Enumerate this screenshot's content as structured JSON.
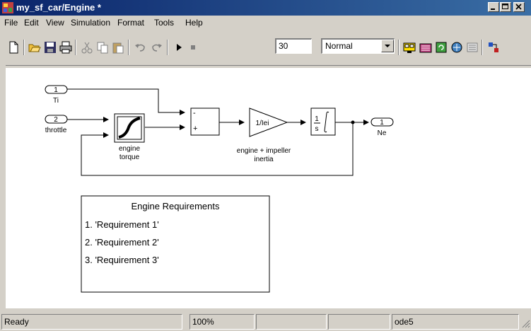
{
  "window": {
    "title": "my_sf_car/Engine *"
  },
  "menu": [
    "File",
    "Edit",
    "View",
    "Simulation",
    "Format",
    "Tools",
    "Help"
  ],
  "toolbar": {
    "stop_time": "30",
    "sim_mode": "Normal"
  },
  "diagram": {
    "inport_ti": {
      "num": "1",
      "label": "Ti"
    },
    "inport_throttle": {
      "num": "2",
      "label": "throttle"
    },
    "engine_torque_label": [
      "engine",
      "torque"
    ],
    "sum_signs": [
      "-",
      "+"
    ],
    "gain": {
      "text": "1/Iei",
      "label": [
        "engine + impeller",
        "inertia"
      ]
    },
    "integrator": {
      "num": "1",
      "den": "s"
    },
    "outport_ne": {
      "num": "1",
      "label": "Ne"
    },
    "requirements": {
      "title": "Engine Requirements",
      "items": [
        "1. 'Requirement 1'",
        "2. 'Requirement 2'",
        "3. 'Requirement 3'"
      ]
    }
  },
  "status": {
    "state": "Ready",
    "zoom": "100%",
    "solver": "ode5"
  }
}
